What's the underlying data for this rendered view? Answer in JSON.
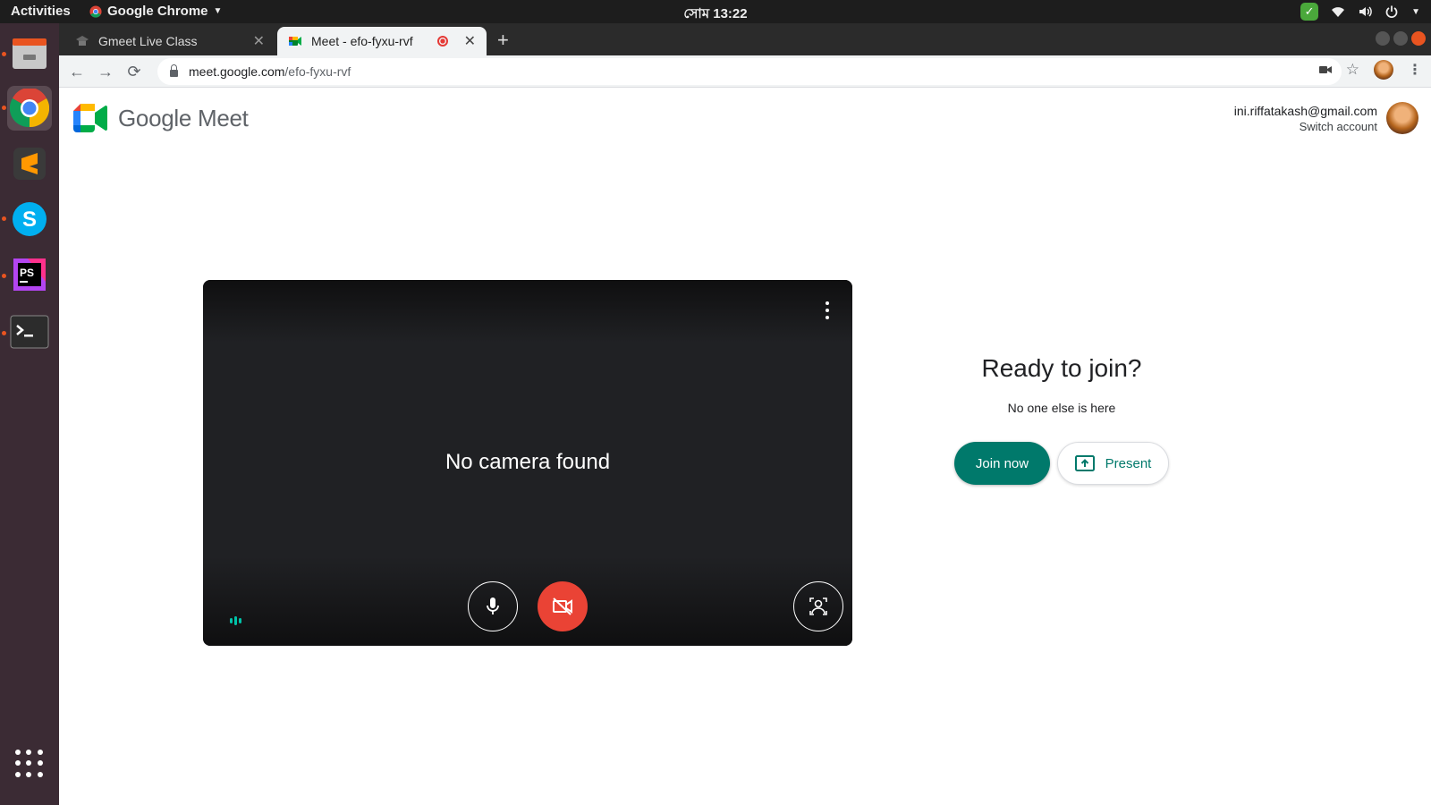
{
  "os": {
    "activities": "Activities",
    "app_name": "Google Chrome",
    "clock": "সোম 13:22",
    "tray_icons": [
      "check-badge-icon",
      "wifi-icon",
      "volume-icon",
      "power-icon",
      "chevron-down-icon"
    ]
  },
  "dock": {
    "items": [
      "files",
      "chrome",
      "sublime-text",
      "skype",
      "phpstorm",
      "terminal"
    ],
    "active": "chrome"
  },
  "browser": {
    "tabs": [
      {
        "title": "Gmeet Live Class",
        "active": false
      },
      {
        "title": "Meet - efo-fyxu-rvf",
        "active": true,
        "recording": true
      }
    ],
    "url_host": "meet.google.com",
    "url_path": "/efo-fyxu-rvf"
  },
  "meet": {
    "brand": "Google Meet",
    "account_email": "ini.riffatakash@gmail.com",
    "switch_account": "Switch account",
    "preview_message": "No camera found",
    "ready_title": "Ready to join?",
    "ready_subtitle": "No one else is here",
    "join_label": "Join now",
    "present_label": "Present",
    "audio_level": 0.3,
    "mic_on": true,
    "camera_on": false
  },
  "colors": {
    "join_button": "#00796b",
    "camera_off": "#ea4335",
    "ubuntu_accent": "#e95420",
    "audio_level": "#00c2a8"
  }
}
